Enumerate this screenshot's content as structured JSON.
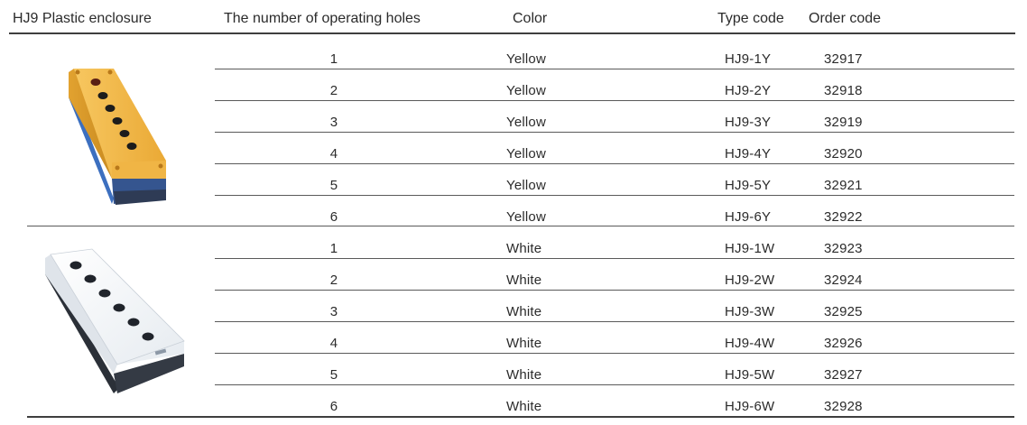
{
  "header": {
    "enclosure": "HJ9 Plastic enclosure",
    "holes": "The number of operating holes",
    "color": "Color",
    "type_code": "Type code",
    "order_code": "Order code"
  },
  "groups": [
    {
      "image": "yellow-enclosure-icon",
      "rows": [
        {
          "holes": "1",
          "color": "Yellow",
          "type": "HJ9-1Y",
          "order": "32917"
        },
        {
          "holes": "2",
          "color": "Yellow",
          "type": "HJ9-2Y",
          "order": "32918"
        },
        {
          "holes": "3",
          "color": "Yellow",
          "type": "HJ9-3Y",
          "order": "32919"
        },
        {
          "holes": "4",
          "color": "Yellow",
          "type": "HJ9-4Y",
          "order": "32920"
        },
        {
          "holes": "5",
          "color": "Yellow",
          "type": "HJ9-5Y",
          "order": "32921"
        },
        {
          "holes": "6",
          "color": "Yellow",
          "type": "HJ9-6Y",
          "order": "32922"
        }
      ]
    },
    {
      "image": "white-enclosure-icon",
      "rows": [
        {
          "holes": "1",
          "color": "White",
          "type": "HJ9-1W",
          "order": "32923"
        },
        {
          "holes": "2",
          "color": "White",
          "type": "HJ9-2W",
          "order": "32924"
        },
        {
          "holes": "3",
          "color": "White",
          "type": "HJ9-3W",
          "order": "32925"
        },
        {
          "holes": "4",
          "color": "White",
          "type": "HJ9-4W",
          "order": "32926"
        },
        {
          "holes": "5",
          "color": "White",
          "type": "HJ9-5W",
          "order": "32927"
        },
        {
          "holes": "6",
          "color": "White",
          "type": "HJ9-6W",
          "order": "32928"
        }
      ]
    }
  ],
  "colors": {
    "yellow_body": "#f2b443",
    "blue_base": "#3f6fb6",
    "white_body": "#f4f6f8",
    "dark_base": "#2c3038"
  }
}
